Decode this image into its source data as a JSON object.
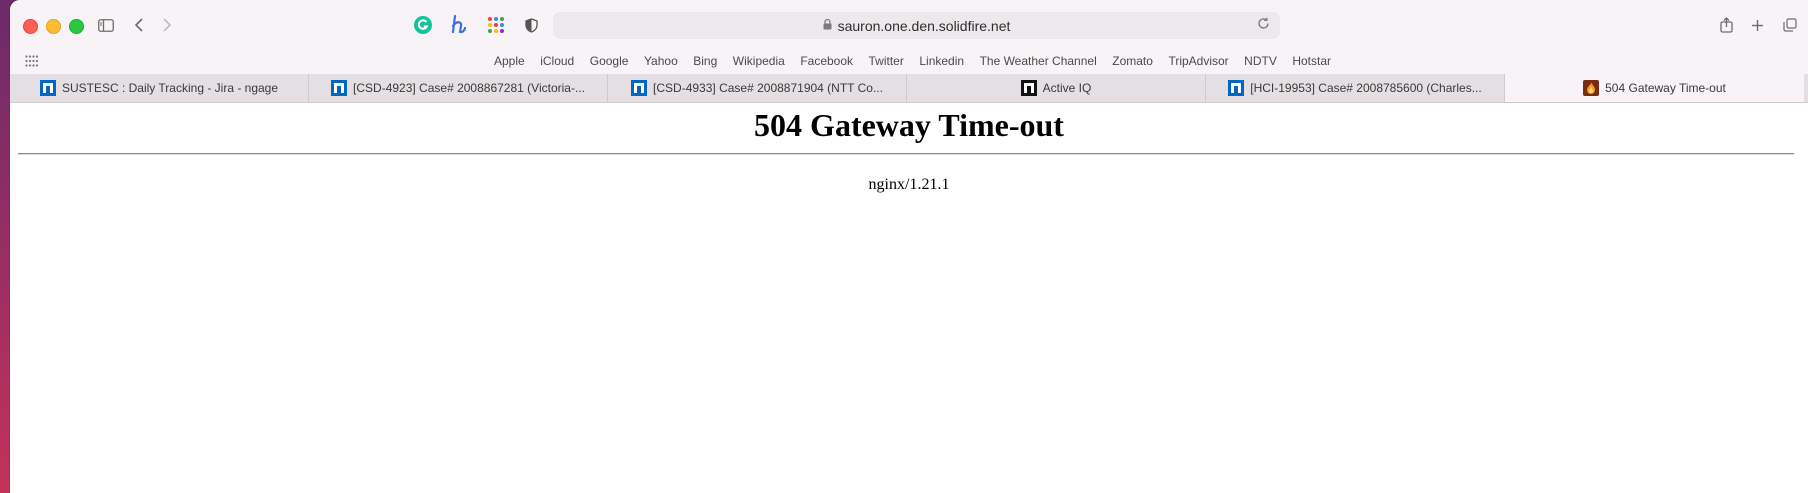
{
  "browser": {
    "url": "sauron.one.den.solidfire.net"
  },
  "favorites": [
    "Apple",
    "iCloud",
    "Google",
    "Yahoo",
    "Bing",
    "Wikipedia",
    "Facebook",
    "Twitter",
    "Linkedin",
    "The Weather Channel",
    "Zomato",
    "TripAdvisor",
    "NDTV",
    "Hotstar"
  ],
  "tabs": [
    {
      "title": "SUSTESC : Daily Tracking - Jira - ngage",
      "icon": "netapp-icon"
    },
    {
      "title": "[CSD-4923] Case# 2008867281 (Victoria-...",
      "icon": "netapp-icon"
    },
    {
      "title": "[CSD-4933] Case# 2008871904 (NTT Co...",
      "icon": "netapp-icon"
    },
    {
      "title": "Active IQ",
      "icon": "netapp-black-icon"
    },
    {
      "title": "[HCI-19953] Case# 2008785600 (Charles...",
      "icon": "netapp-icon"
    },
    {
      "title": "504 Gateway Time-out",
      "icon": "fire-icon",
      "active": true
    }
  ],
  "page": {
    "heading": "504 Gateway Time-out",
    "server": "nginx/1.21.1"
  },
  "colors": {
    "netapp_blue": "#0067c5",
    "close": "#fe5f57",
    "minimize": "#febc2e",
    "maximize": "#28c840"
  }
}
